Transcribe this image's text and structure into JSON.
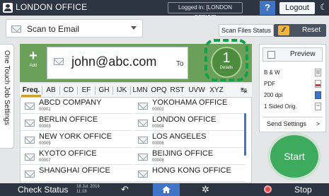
{
  "titlebar": {
    "title": "LONDON OFFICE",
    "login_status": "Logged in: [LONDON OFFICE]",
    "help_label": "?",
    "logout_label": "Logout"
  },
  "function_select": {
    "label": "Scan to Email"
  },
  "scan_files_status_label": "Scan Files Status",
  "reset_label": "Reset",
  "side_tab_label": "One Touch Job Settings",
  "destination": {
    "add_label": "Add",
    "address": "john@abc.com",
    "to_label": "To",
    "count": "1",
    "details_label": "Details"
  },
  "tabs": [
    {
      "label": "Freq."
    },
    {
      "label": "AB"
    },
    {
      "label": "CD"
    },
    {
      "label": "EF"
    },
    {
      "label": "GH"
    },
    {
      "label": "IJK"
    },
    {
      "label": "LMN"
    },
    {
      "label": "OPQ"
    },
    {
      "label": "RST"
    },
    {
      "label": "UVW"
    },
    {
      "label": "XYZ"
    }
  ],
  "entries": [
    {
      "name": "ABCD COMPANY",
      "number": "00001"
    },
    {
      "name": "YOKOHAMA OFFICE",
      "number": "00002"
    },
    {
      "name": "BERLIN OFFICE",
      "number": "00003"
    },
    {
      "name": "LONDON OFFICE",
      "number": "00004"
    },
    {
      "name": "NEW YORK OFFICE",
      "number": "00005"
    },
    {
      "name": "LOS ANGELES",
      "number": "00006"
    },
    {
      "name": "KYOTO OFFICE",
      "number": "00007"
    },
    {
      "name": "BEIJING OFFICE",
      "number": "00008"
    },
    {
      "name": "SHANGHAI OFFICE",
      "number": ""
    },
    {
      "name": "HONG KONG OFFICE",
      "number": ""
    }
  ],
  "right_panel": {
    "preview_label": "Preview",
    "settings": [
      "B & W",
      "PDF",
      "200 dpi",
      "1 Sided Orig."
    ],
    "send_settings_label": "Send Settings",
    "send_settings_arrow": ">"
  },
  "start_label": "Start",
  "bottombar": {
    "check_status_label": "Check Status",
    "date": "18 Jul. 2018",
    "time": "11:18",
    "stop_label": "Stop"
  },
  "colors": {
    "accent_green": "#6aa05a",
    "start_green": "#3daa5e",
    "highlight_green": "#12a04a",
    "home_blue": "#3f74c7"
  }
}
